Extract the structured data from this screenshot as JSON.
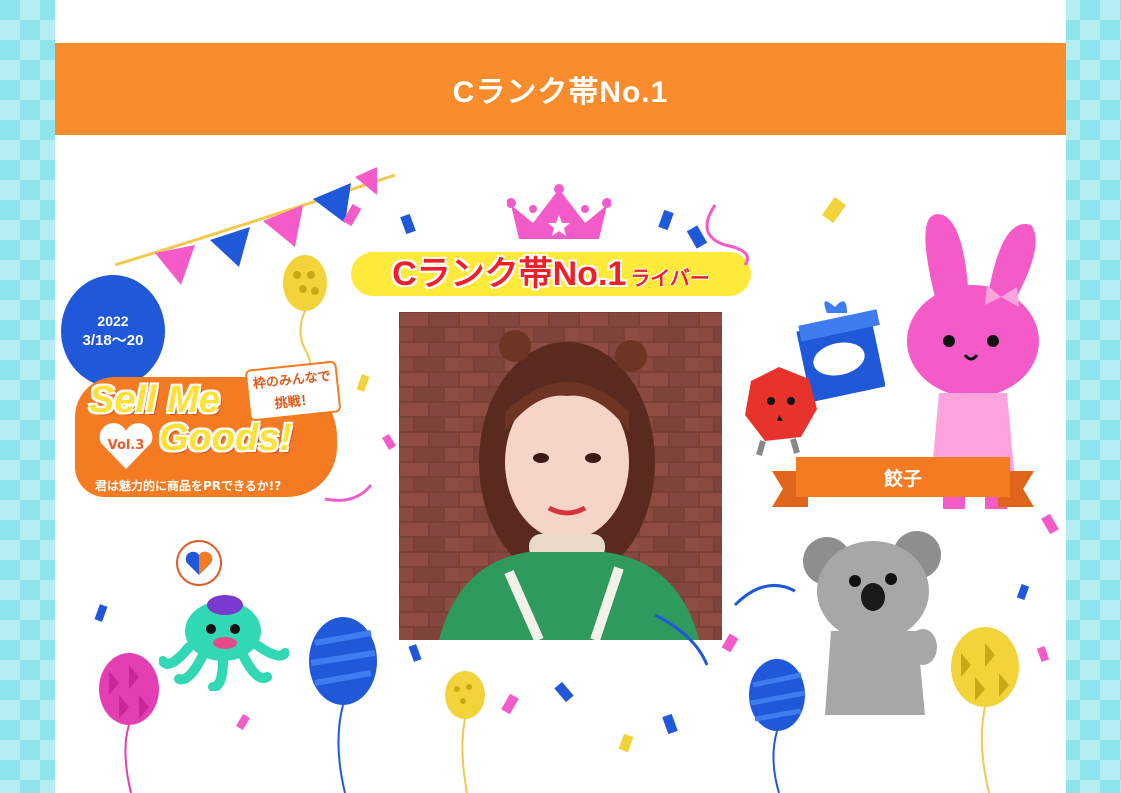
{
  "header": {
    "title": "Cランク帯No.1"
  },
  "event": {
    "date_year": "2022",
    "date_range": "3/18～20",
    "logo_line1": "Sell Me",
    "logo_line2": "Goods!",
    "logo_vol": "Vol.3",
    "logo_tag_line1": "枠のみんなで",
    "logo_tag_line2": "挑戦！",
    "logo_subtitle": "君は魅力的に商品をPRできるか!?"
  },
  "winner": {
    "rank_title": "Cランク帯No.1",
    "rank_suffix": "ライバー",
    "name": "餃子"
  },
  "colors": {
    "banner": "#f98d2d",
    "accent_blue": "#1f58d8",
    "accent_pink": "#f45bc9",
    "accent_yellow": "#ffe93a",
    "background_tile": "#8ee4ec"
  }
}
